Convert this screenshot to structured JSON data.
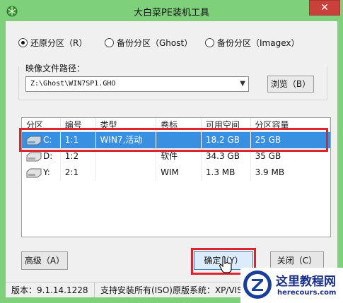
{
  "window": {
    "title": "大白菜PE装机工具",
    "close_glyph": "✕"
  },
  "mode_options": [
    {
      "label": "还原分区（R）",
      "selected": true
    },
    {
      "label": "备份分区（Ghost）",
      "selected": false
    },
    {
      "label": "备份分区（Imagex）",
      "selected": false
    }
  ],
  "image_path": {
    "label": "映像文件路径：",
    "value": "Z:\\Ghost\\WIN7SP1.GHO",
    "browse_label": "浏览（B）"
  },
  "table": {
    "columns": [
      "分区",
      "编号",
      "类型",
      "卷标",
      "可用空间",
      "分区容量"
    ],
    "rows": [
      {
        "drive": "C:",
        "number": "1:1",
        "type": "WIN7,活动",
        "label": "",
        "free": "18.2 GB",
        "size": "25 GB",
        "selected": true
      },
      {
        "drive": "D:",
        "number": "1:2",
        "type": "",
        "label": "软件",
        "free": "34.3 GB",
        "size": "35 GB",
        "selected": false
      },
      {
        "drive": "Y:",
        "number": "2:1",
        "type": "",
        "label": "WIM",
        "free": "1.3 MB",
        "size": "3.9 MB",
        "selected": false
      }
    ]
  },
  "buttons": {
    "advanced": "高级（A）",
    "ok": "确定（Y）",
    "close": "关闭（C）"
  },
  "status": {
    "version": "版本：9.1.14.1228",
    "support": "支持安装所有(ISO)原版系统：XP/VIST"
  },
  "watermark": {
    "title": "这里教程网",
    "url": "herecours.com"
  },
  "colors": {
    "title_bar": "#7fd07a",
    "selection": "#3a90e0",
    "highlight_box": "#e0242f"
  }
}
